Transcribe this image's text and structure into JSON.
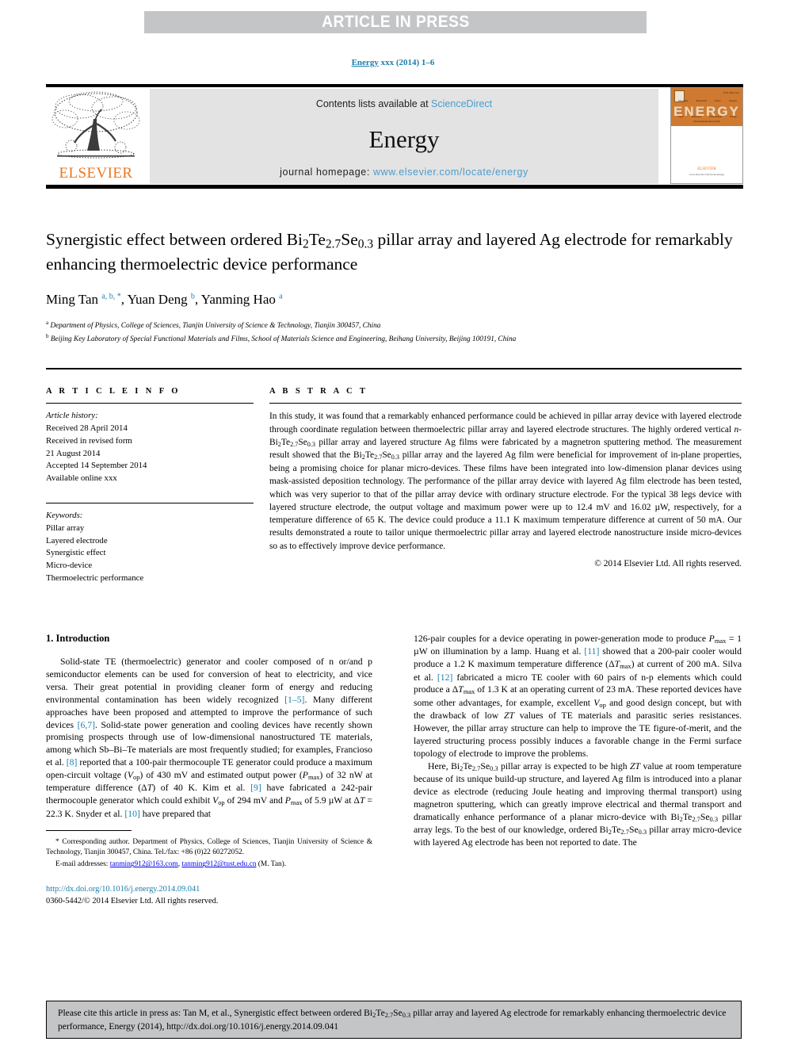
{
  "banner": {
    "label": "ARTICLE IN PRESS"
  },
  "running_head": {
    "journal": "Energy",
    "issue": "xxx (2014) 1–6"
  },
  "masthead": {
    "contents_prefix": "Contents lists available at ",
    "contents_link": "ScienceDirect",
    "journal_name": "Energy",
    "homepage_prefix": "journal homepage: ",
    "homepage_link": "www.elsevier.com/locate/energy",
    "publisher": "ELSEVIER",
    "logo_icon": "elsevier-tree-icon"
  },
  "cover": {
    "title": "ENERGY",
    "subtitle": "The International Journal",
    "footer_brand": "ELSEVIER",
    "footer_line": "www.elsevier.com/locate/energy",
    "issue_code": "ISSN 0360-5442",
    "row_labels": [
      "Modelling",
      "Renewable",
      "Policy",
      "Systems"
    ],
    "row2_labels": [
      "Fuels",
      "Efficiency",
      "Environment",
      "Exergy"
    ]
  },
  "article": {
    "title": "Synergistic effect between ordered Bi2Te2.7Se0.3 pillar array and layered Ag electrode for remarkably enhancing thermoelectric device performance",
    "authors_plain": "Ming Tan a, b, *, Yuan Deng b, Yanming Hao a",
    "affiliation_a": "Department of Physics, College of Sciences, Tianjin University of Science & Technology, Tianjin 300457, China",
    "affiliation_b": "Beijing Key Laboratory of Special Functional Materials and Films, School of Materials Science and Engineering, Beihang University, Beijing 100191, China"
  },
  "article_info": {
    "heading": "A R T I C L E   I N F O",
    "history_label": "Article history:",
    "history": [
      "Received 28 April 2014",
      "Received in revised form",
      "21 August 2014",
      "Accepted 14 September 2014",
      "Available online xxx"
    ],
    "keywords_label": "Keywords:",
    "keywords": [
      "Pillar array",
      "Layered electrode",
      "Synergistic effect",
      "Micro-device",
      "Thermoelectric performance"
    ]
  },
  "abstract": {
    "heading": "A B S T R A C T",
    "copyright": "© 2014 Elsevier Ltd. All rights reserved."
  },
  "introduction": {
    "heading": "1.  Introduction"
  },
  "footnote": {
    "corresponding": "Corresponding author. Department of Physics, College of Sciences, Tianjin University of Science & Technology, Tianjin 300457, China. Tel./fax: +86 (0)22 60272052.",
    "email_label": "E-mail addresses:",
    "email1": "tanming912@163.com",
    "email2": "tanming912@tust.edu.cn",
    "email_suffix": "(M. Tan).",
    "doi_url": "http://dx.doi.org/10.1016/j.energy.2014.09.041",
    "issn_line": "0360-5442/© 2014 Elsevier Ltd. All rights reserved."
  },
  "cite_footer": {
    "text": "Please cite this article in press as: Tan M, et al., Synergistic effect between ordered Bi2Te2.7Se0.3 pillar array and layered Ag electrode for remarkably enhancing thermoelectric device performance, Energy (2014), http://dx.doi.org/10.1016/j.energy.2014.09.041"
  },
  "colors": {
    "link": "#1a7eab",
    "banner_grey": "#c3c5c7",
    "panel_grey": "#e3e3e3",
    "elsevier_orange": "#e87722"
  }
}
